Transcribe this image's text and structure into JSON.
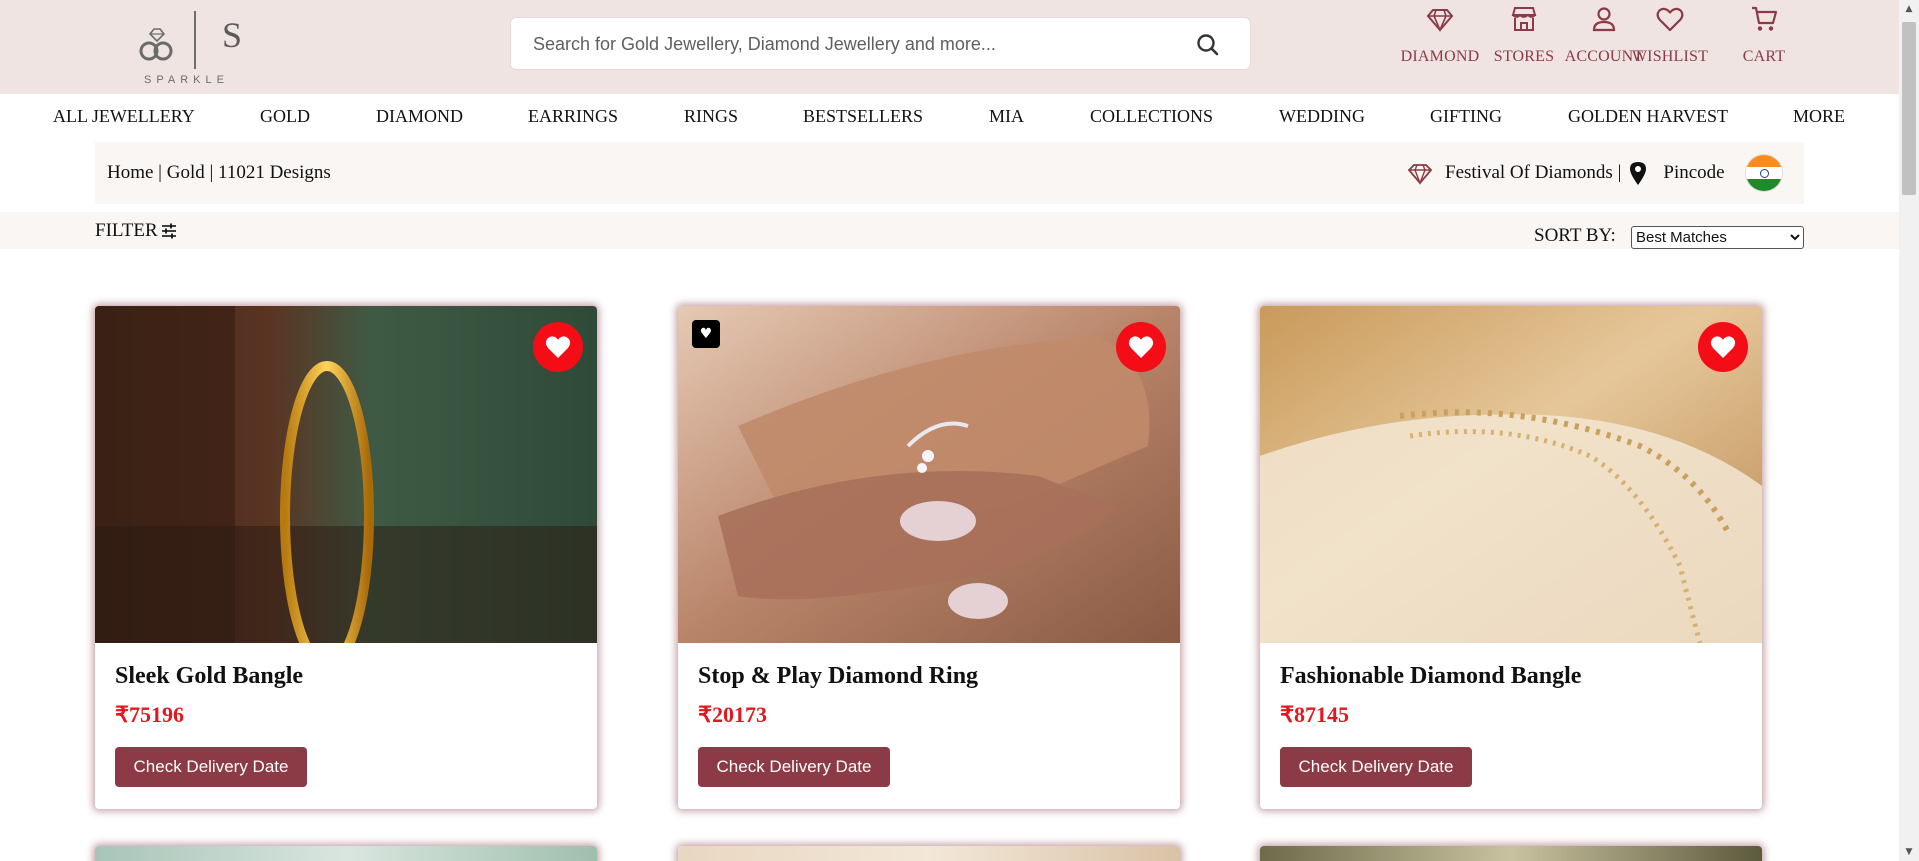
{
  "header": {
    "brand": "SPARKLE",
    "brand_letter": "S",
    "search_placeholder": "Search for Gold Jewellery, Diamond Jewellery and more...",
    "icons": [
      {
        "label": "DIAMOND",
        "icon": "diamond-icon"
      },
      {
        "label": "STORES",
        "icon": "store-icon"
      },
      {
        "label": "ACCOUNT",
        "icon": "account-icon"
      },
      {
        "label": "WISHLIST",
        "icon": "heart-icon"
      },
      {
        "label": "CART",
        "icon": "cart-icon"
      }
    ]
  },
  "nav": {
    "items": [
      "ALL JEWELLERY",
      "GOLD",
      "DIAMOND",
      "EARRINGS",
      "RINGS",
      "BESTSELLERS",
      "MIA",
      "COLLECTIONS",
      "WEDDING",
      "GIFTING",
      "GOLDEN HARVEST",
      "MORE"
    ]
  },
  "breadcrumb": {
    "text": "Home | Gold | 11021 Designs",
    "festival": "Festival Of Diamonds |",
    "pincode": "Pincode"
  },
  "toolbar": {
    "filter_label": "FILTER",
    "sort_label": "SORT BY:",
    "sort_value": "Best Matches"
  },
  "products": [
    {
      "name": "Sleek Gold Bangle",
      "price": "₹75196",
      "button": "Check Delivery Date",
      "wishlisted": true
    },
    {
      "name": "Stop & Play Diamond Ring",
      "price": "₹20173",
      "button": "Check Delivery Date",
      "wishlisted": true,
      "badge": "♥"
    },
    {
      "name": "Fashionable Diamond Bangle",
      "price": "₹87145",
      "button": "Check Delivery Date",
      "wishlisted": true
    }
  ],
  "colors": {
    "header_bg": "#efe4e2",
    "accent": "#8b3a46",
    "price": "#e0191f",
    "wishlist": "#f40d16"
  }
}
